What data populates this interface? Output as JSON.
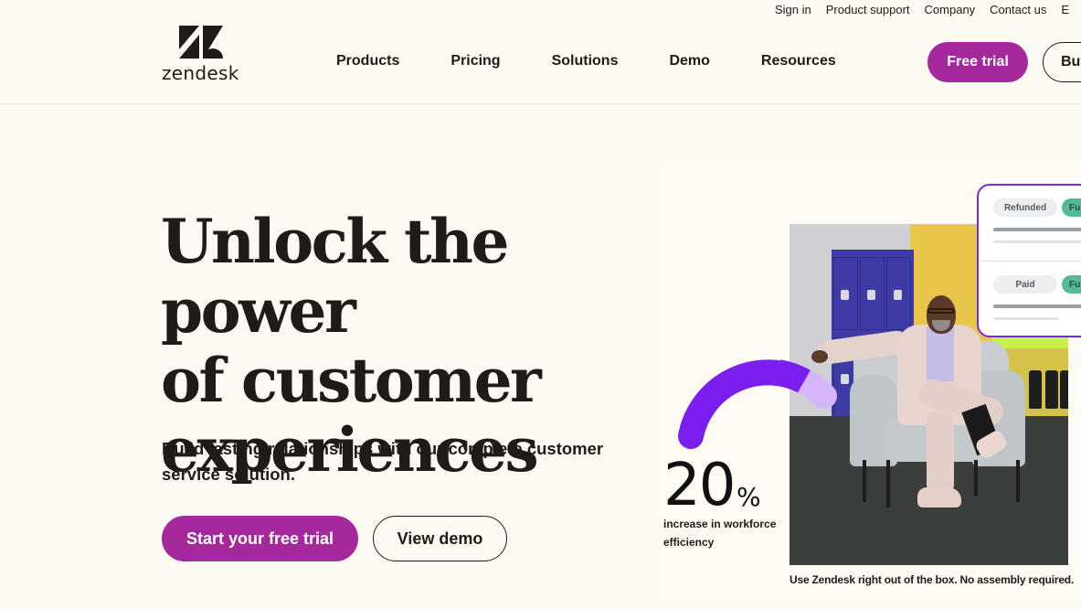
{
  "utility_nav": {
    "items": [
      "Sign in",
      "Product support",
      "Company",
      "Contact us",
      "E"
    ]
  },
  "brand": {
    "name": "zendesk",
    "logo_icon": "zendesk-logo-icon"
  },
  "main_nav": {
    "items": [
      "Products",
      "Pricing",
      "Solutions",
      "Demo",
      "Resources"
    ]
  },
  "header_actions": {
    "free_trial_label": "Free trial",
    "buy_label": "Buy"
  },
  "hero": {
    "title_lines": [
      "Unlock the power",
      "of customer",
      "experiences"
    ],
    "subtitle": "Build lasting relationships with our complete customer service solution.",
    "primary_cta": "Start your free trial",
    "secondary_cta": "View demo"
  },
  "media": {
    "stat_value": "20",
    "stat_unit": "%",
    "stat_caption": "increase in workforce efficiency",
    "photo_caption": "Use Zendesk right out of the box. No assembly required.",
    "photo_description": "man in light suit sitting in grey armchair in front of blue lockers and yellow wall",
    "ticket_card": {
      "rows": [
        {
          "status": "Refunded",
          "tag": "Fu"
        },
        {
          "status": "Paid",
          "tag": "Fu"
        }
      ]
    }
  },
  "colors": {
    "background": "#fdf9f3",
    "brand_primary": "#a5299c",
    "text": "#1f1c18",
    "accent_purple": "#7a2ae6",
    "accent_purple_light": "#d4b4fb",
    "tag_green": "#56b899"
  }
}
